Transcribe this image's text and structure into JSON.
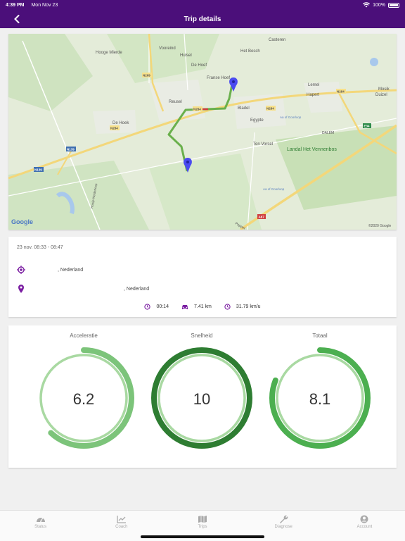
{
  "status_bar": {
    "time": "4:39 PM",
    "date": "Mon Nov 23",
    "battery": "100%"
  },
  "header": {
    "title": "Trip details"
  },
  "map": {
    "places": [
      "Casteren",
      "Vooreind",
      "Hooge Mierde",
      "Hulsel",
      "Het Bosch",
      "De Hoef",
      "Franse Hoef",
      "Reusel",
      "Bladel",
      "Lemel",
      "Hapert",
      "Mosik",
      "Duizel",
      "De Hoek",
      "Egypte",
      "DALEM",
      "Ten Vorsel",
      "Landal Het Vennenbos",
      "Aa of Goorloop",
      "Aa of Goorloop",
      "Rooije Nelderloop",
      "Poppel"
    ],
    "roads": [
      "N269",
      "N284",
      "N284",
      "N284",
      "N284",
      "N139",
      "N139",
      "E34",
      "A67"
    ],
    "attribution": "©2020 Google",
    "logo": "Google",
    "colors": {
      "route": "#6ab04c",
      "pin": "#4a4af0"
    }
  },
  "trip": {
    "datetime": "23 nov. 08:33 - 08:47",
    "start_address": ", Nederland",
    "end_address": ", Nederland",
    "duration": "00:14",
    "distance": "7.41 km",
    "avg_speed": "31.79 km/u"
  },
  "scores": [
    {
      "label": "Acceleratie",
      "value": "6.2",
      "fraction": 0.62,
      "color": "#7cc47a",
      "track": "#a9d9a2"
    },
    {
      "label": "Snelheid",
      "value": "10",
      "fraction": 1.0,
      "color": "#2e7d32",
      "track": "#a9d9a2"
    },
    {
      "label": "Totaal",
      "value": "8.1",
      "fraction": 0.81,
      "color": "#4caf50",
      "track": "#a9d9a2"
    }
  ],
  "tabs": [
    {
      "label": "Status",
      "icon": "speedometer-icon"
    },
    {
      "label": "Coach",
      "icon": "chart-icon"
    },
    {
      "label": "Trips",
      "icon": "map-icon"
    },
    {
      "label": "Diagnose",
      "icon": "wrench-icon"
    },
    {
      "label": "Account",
      "icon": "person-icon"
    }
  ],
  "brand_color": "#4b0f7a"
}
